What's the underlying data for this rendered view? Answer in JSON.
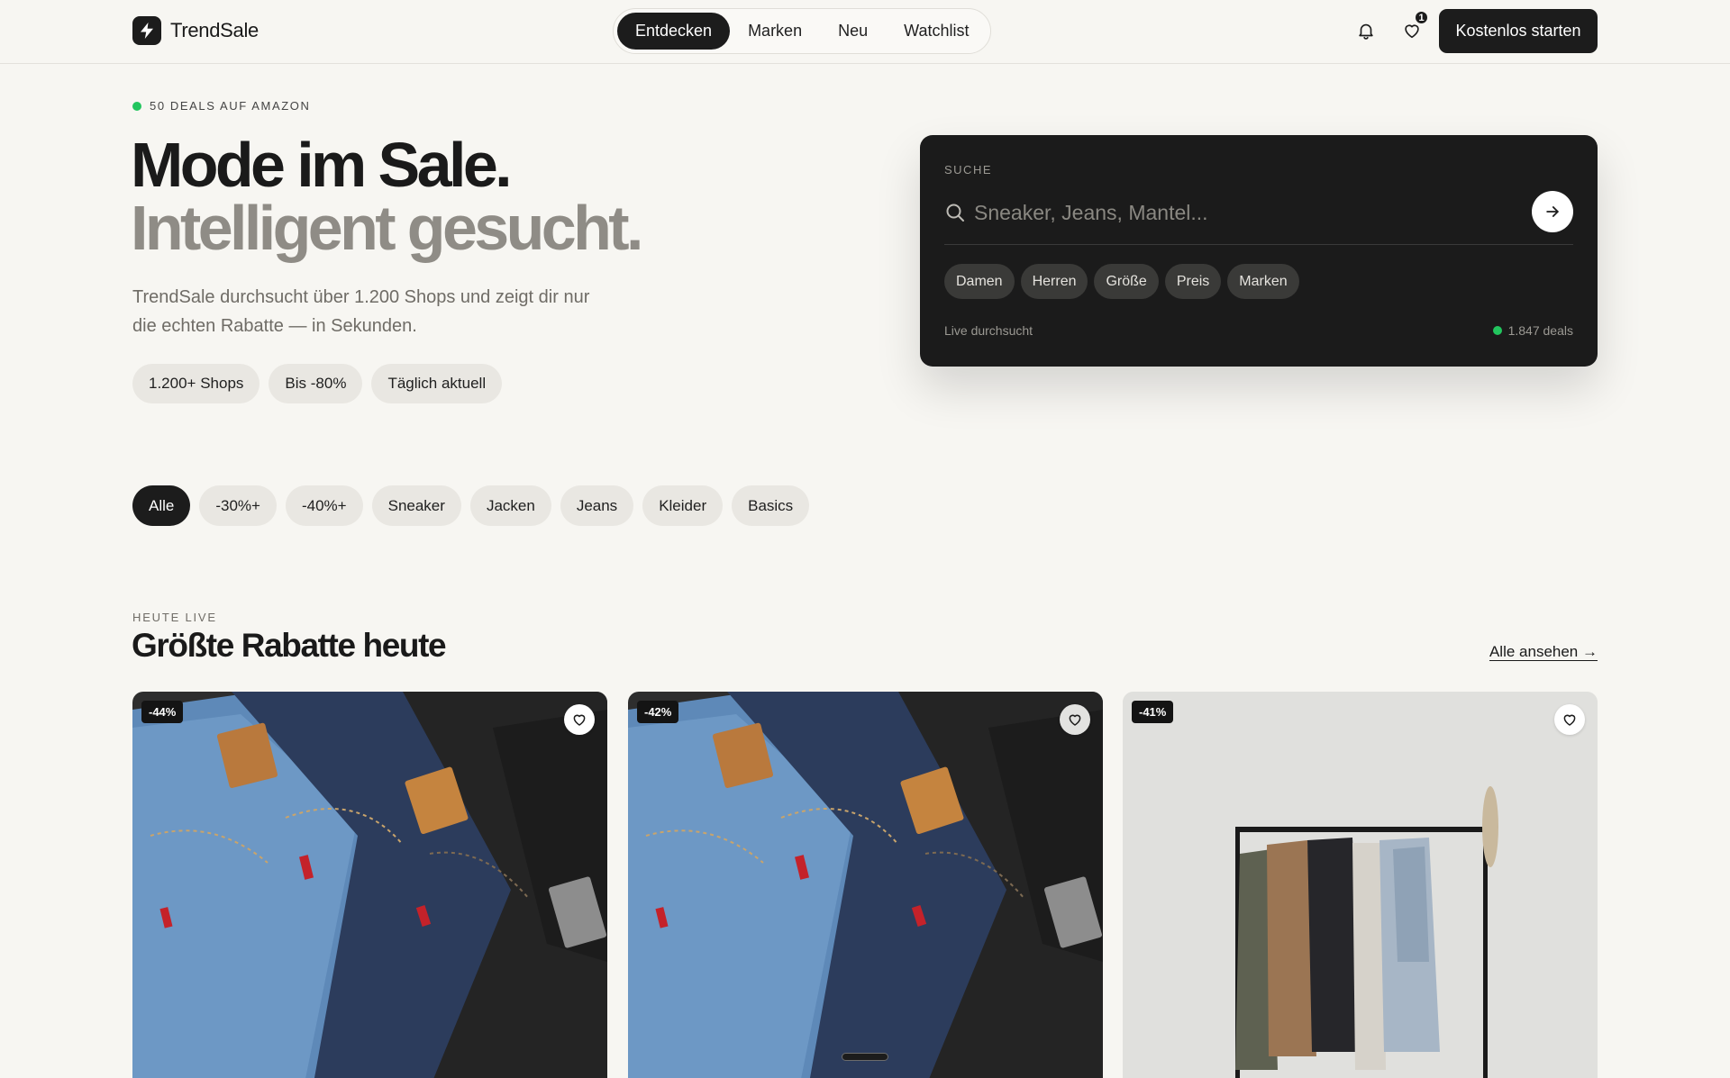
{
  "header": {
    "brand": "TrendSale",
    "nav": [
      {
        "label": "Entdecken",
        "active": true
      },
      {
        "label": "Marken",
        "active": false
      },
      {
        "label": "Neu",
        "active": false
      },
      {
        "label": "Watchlist",
        "active": false
      }
    ],
    "wishlist_count": "1",
    "cta_label": "Kostenlos starten",
    "icons": [
      "bell-icon",
      "heart-icon"
    ]
  },
  "hero": {
    "eyebrow": "50 DEALS AUF AMAZON",
    "title_line1": "Mode im Sale.",
    "title_line2": "Intelligent gesucht.",
    "lead": "TrendSale durchsucht über 1.200 Shops und zeigt dir nur die echten Rabatte — in Sekunden.",
    "stats": [
      "1.200+ Shops",
      "Bis -80%",
      "Täglich aktuell"
    ]
  },
  "search": {
    "label": "SUCHE",
    "placeholder": "Sneaker, Jeans, Mantel...",
    "value": "",
    "chips": [
      "Damen",
      "Herren",
      "Größe",
      "Preis",
      "Marken"
    ],
    "footer_left": "Live durchsucht",
    "footer_right": "1.847 deals"
  },
  "filters": [
    {
      "label": "Alle",
      "active": true
    },
    {
      "label": "-30%+",
      "active": false
    },
    {
      "label": "-40%+",
      "active": false
    },
    {
      "label": "Sneaker",
      "active": false
    },
    {
      "label": "Jacken",
      "active": false
    },
    {
      "label": "Jeans",
      "active": false
    },
    {
      "label": "Kleider",
      "active": false
    },
    {
      "label": "Basics",
      "active": false
    }
  ],
  "section": {
    "eyebrow": "HEUTE LIVE",
    "title": "Größte Rabatte heute",
    "link": "Alle ansehen →"
  },
  "products": [
    {
      "discount": "-44%",
      "image": "jeans-stack"
    },
    {
      "discount": "-42%",
      "image": "jeans-stack"
    },
    {
      "discount": "-41%",
      "image": "clothing-rack"
    }
  ],
  "colors": {
    "background": "#f7f6f2",
    "ink": "#1c1c1c",
    "chip": "#e9e7e2",
    "live": "#22c55e"
  }
}
